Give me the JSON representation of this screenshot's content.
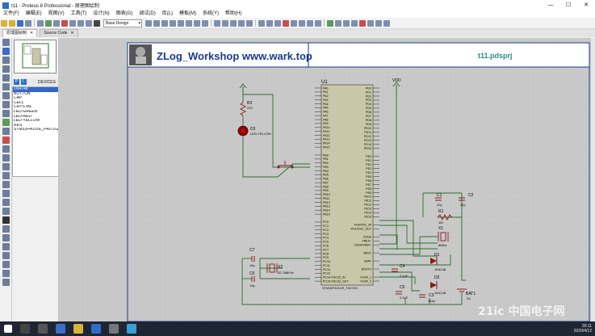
{
  "window": {
    "title": "t11 - Proteus 8 Professional - 原理图绘制"
  },
  "menu": [
    "文件(F)",
    "编辑(E)",
    "视图(V)",
    "工具(T)",
    "设计(N)",
    "图表(G)",
    "调试(D)",
    "库(L)",
    "模板(M)",
    "系统(Y)",
    "帮助(H)"
  ],
  "toolbar": {
    "design_select": "Base Design"
  },
  "tabs": [
    {
      "label": "原理图绘制"
    },
    {
      "label": "Source Code"
    }
  ],
  "device_panel": {
    "p_label": "P",
    "l_label": "L",
    "header": "DEVICES",
    "items": [
      "1N4148",
      "BUTTON",
      "CAP",
      "CELL",
      "CRYSTAL",
      "LED-GREEN",
      "LED-RED",
      "LED-YELLOW",
      "RES",
      "STM32F401VE_F407ZG"
    ],
    "selected_index": 0
  },
  "schematic": {
    "banner_title": "ZLog_Workshop  www.wark.top",
    "project_file": "t11.pdsprj",
    "chip_ref": "U1",
    "chip_part": "STM32F401VE_F407ZG",
    "vdd_label": "VDD",
    "left_pins": [
      "PA0",
      "PA1",
      "PA2",
      "PA3",
      "PA4",
      "PA5",
      "PA6",
      "PA7",
      "PA8",
      "PA9",
      "PA10",
      "PA11",
      "PA12",
      "PA13",
      "PA14",
      "PA15",
      "",
      "PB0",
      "PB1",
      "PB2",
      "PB3",
      "PB4",
      "PB5",
      "PB6",
      "PB7",
      "PB8",
      "PB9",
      "PB10",
      "PB11",
      "PB12",
      "PB13",
      "PB14",
      "PB15",
      "",
      "PC0",
      "PC1",
      "PC2",
      "PC3",
      "PC4",
      "PC5",
      "PC6",
      "PC7",
      "PC8",
      "PC9",
      "PC10",
      "PC11",
      "PC12",
      "PC13",
      "PC14-OSC32_IN",
      "PC15-OSC32_OUT"
    ],
    "right_pins": [
      "PD0",
      "PD1",
      "PD2",
      "PD3",
      "PD4",
      "PD5",
      "PD6",
      "PD7",
      "PD8",
      "PD9",
      "PD10",
      "PD11",
      "PD12",
      "PD13",
      "PD14",
      "PD15",
      "",
      "PE0",
      "PE1",
      "PE2",
      "PE3",
      "PE4",
      "PE5",
      "PE6",
      "PE7",
      "PE8",
      "PE9",
      "PE10",
      "PE11",
      "PE12",
      "PE13",
      "PE14",
      "PE15",
      "",
      "PH0/OSC_IN",
      "PH1/OSC_OUT",
      "",
      "VDDA",
      "VREF+",
      "VSSA/VREF-",
      "",
      "NRST",
      "",
      "VBAT",
      "",
      "BOOT0",
      "",
      "VCAP_1",
      "VCAP_2"
    ],
    "components": [
      {
        "ref": "R2",
        "value": "220"
      },
      {
        "ref": "D3",
        "value": "LED-YELLOW"
      },
      {
        "ref": "C1",
        "value": "22p"
      },
      {
        "ref": "C2",
        "value": "22p"
      },
      {
        "ref": "R1",
        "value": "1M"
      },
      {
        "ref": "X1",
        "value": "8MHz"
      },
      {
        "ref": "C7",
        "value": "10p"
      },
      {
        "ref": "C6",
        "value": "10p"
      },
      {
        "ref": "X2",
        "value": "32.768KHz"
      },
      {
        "ref": "C4",
        "value": "2.2uF"
      },
      {
        "ref": "C5",
        "value": "2.2uF"
      },
      {
        "ref": "C3",
        "value": "104p"
      },
      {
        "ref": "D1",
        "value": "1N4148"
      },
      {
        "ref": "D2",
        "value": "1N4148"
      },
      {
        "ref": "BAT1",
        "value": "3V"
      }
    ]
  },
  "taskbar": {
    "time": "20:11",
    "date": "2020/4/12"
  },
  "watermark": "21ic 中国电子网",
  "colors": {
    "sheet_bg": "#dcdcdc",
    "chip_fill": "#c8c8a8",
    "wire": "#2c6e2c",
    "component": "#8b1a1a",
    "banner_border": "#1a3a8a"
  }
}
